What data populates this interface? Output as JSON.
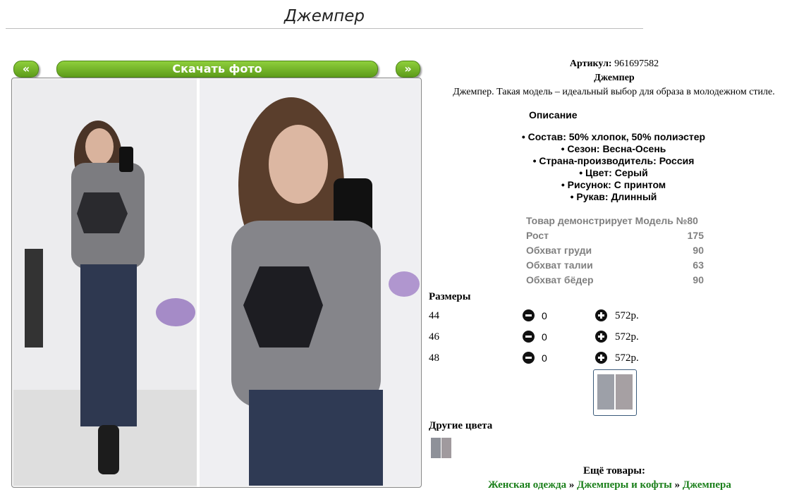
{
  "page": {
    "title": "Джемпер"
  },
  "gallery": {
    "prev_label": "«",
    "download_label": "Скачать фото",
    "next_label": "»"
  },
  "product": {
    "article_label": "Артикул:",
    "article_value": "961697582",
    "name": "Джемпер",
    "description": "Джемпер. Такая модель – идеальный выбор для образа в молодежном стиле.",
    "description_heading": "Описание",
    "properties": [
      "• Состав: 50% хлопок, 50% полиэстер",
      "• Сезон: Весна-Осень",
      "• Страна-производитель: Россия",
      "• Цвет: Серый",
      "• Рисунок: С принтом",
      "• Рукав: Длинный"
    ]
  },
  "model": [
    {
      "label": "Товар демонстрирует Модель №80",
      "value": ""
    },
    {
      "label": "Рост",
      "value": "175"
    },
    {
      "label": "Обхват груди",
      "value": "90"
    },
    {
      "label": "Обхват талии",
      "value": "63"
    },
    {
      "label": "Обхват бёдер",
      "value": "90"
    }
  ],
  "sizes": {
    "heading": "Размеры",
    "rows": [
      {
        "size": "44",
        "qty": "0",
        "price": "572р."
      },
      {
        "size": "46",
        "qty": "0",
        "price": "572р."
      },
      {
        "size": "48",
        "qty": "0",
        "price": "572р."
      }
    ]
  },
  "other_colors_heading": "Другие цвета",
  "more": {
    "heading": "Ещё товары:",
    "crumbs": [
      "Женская одежда",
      "Джемперы и кофты",
      "Джемпера"
    ],
    "separator": "»"
  },
  "colors": {
    "accent_green": "#6aad24",
    "link_green": "#1a7f1a",
    "muted_gray": "#808080"
  },
  "icons": {
    "minus": "minus-circle-icon",
    "plus": "plus-circle-icon"
  }
}
